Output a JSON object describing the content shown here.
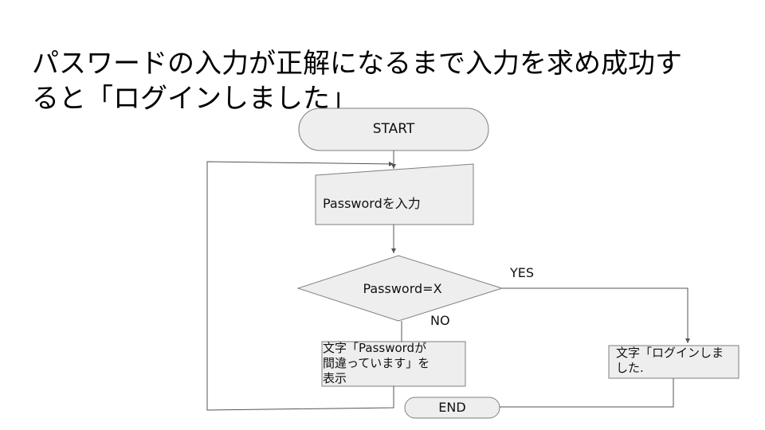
{
  "slide": {
    "title_line1": "パスワードの入力が正解になるまで入力を求め成功す",
    "title_line2": "ると「ログインしました」"
  },
  "flowchart": {
    "start": "START",
    "input": "Passwordを入力",
    "decision": "Password=X",
    "yes": "YES",
    "no": "NO",
    "error_line1": "文字「Passwordが",
    "error_line2": "間違っています」を",
    "error_line3": "表示",
    "success_line1": "文字「ログインしま",
    "success_line2": "した.",
    "end": "END"
  },
  "colors": {
    "shape_fill": "#eeeeee",
    "shape_stroke": "#7f7f7f",
    "line": "#555555"
  }
}
